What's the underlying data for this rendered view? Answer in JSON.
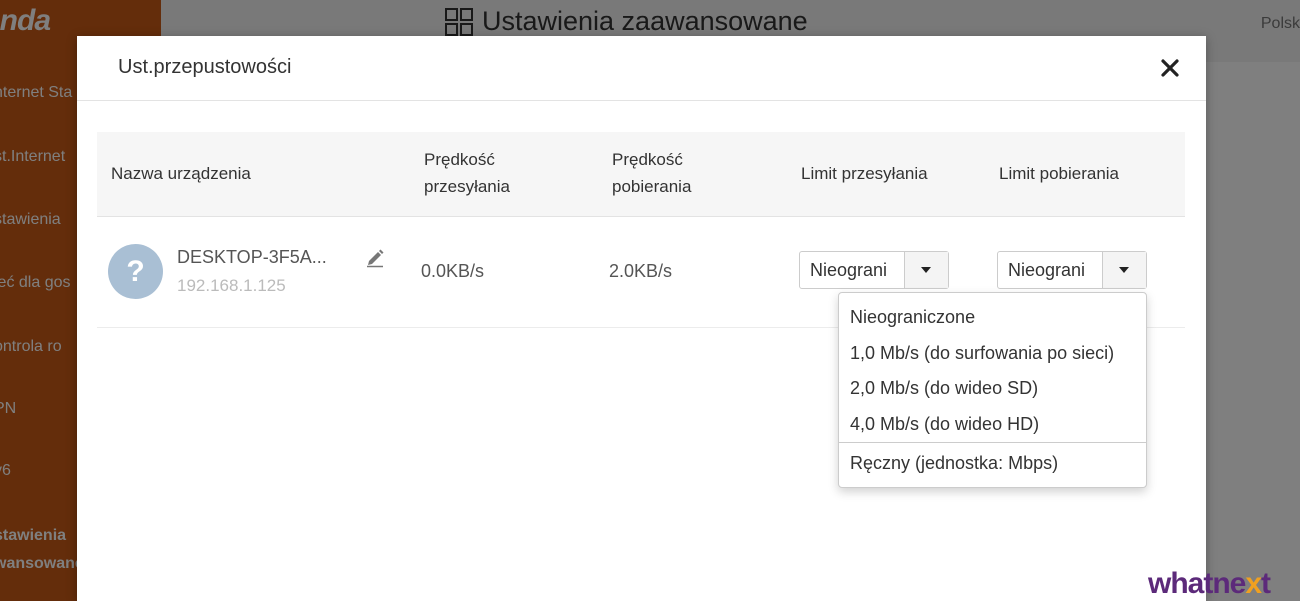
{
  "background": {
    "logo": "enda",
    "sidebar_items": [
      "nternet Sta",
      "st.Internet",
      "stawienia",
      "ieć dla gos",
      "ontrola ro",
      "PN",
      "v6",
      "stawienia",
      "wansowane"
    ],
    "page_title": "Ustawienia zaawansowane",
    "language": "Polsk"
  },
  "modal": {
    "title": "Ust.przepustowości",
    "columns": {
      "device_name": "Nazwa urządzenia",
      "upload_speed_1": "Prędkość",
      "upload_speed_2": "przesyłania",
      "download_speed_1": "Prędkość",
      "download_speed_2": "pobierania",
      "upload_limit": "Limit przesyłania",
      "download_limit": "Limit pobierania"
    },
    "device": {
      "avatar_glyph": "?",
      "name": "DESKTOP-3F5A...",
      "ip": "192.168.1.125",
      "upload_speed": "0.0KB/s",
      "download_speed": "2.0KB/s",
      "upload_limit": "Nieograni",
      "download_limit": "Nieograni"
    },
    "dropdown_options": [
      "Nieograniczone",
      "1,0 Mb/s (do surfowania po sieci)",
      "2,0 Mb/s (do wideo SD)",
      "4,0 Mb/s (do wideo HD)",
      "Ręczny (jednostka: Mbps)"
    ]
  },
  "watermark": {
    "part1": "what",
    "part2": "ne",
    "part3": "x",
    "part4": "t"
  },
  "colors": {
    "sidebar": "#c85a16",
    "avatar": "#a9bfd4",
    "watermark": "#5c2a7a"
  }
}
